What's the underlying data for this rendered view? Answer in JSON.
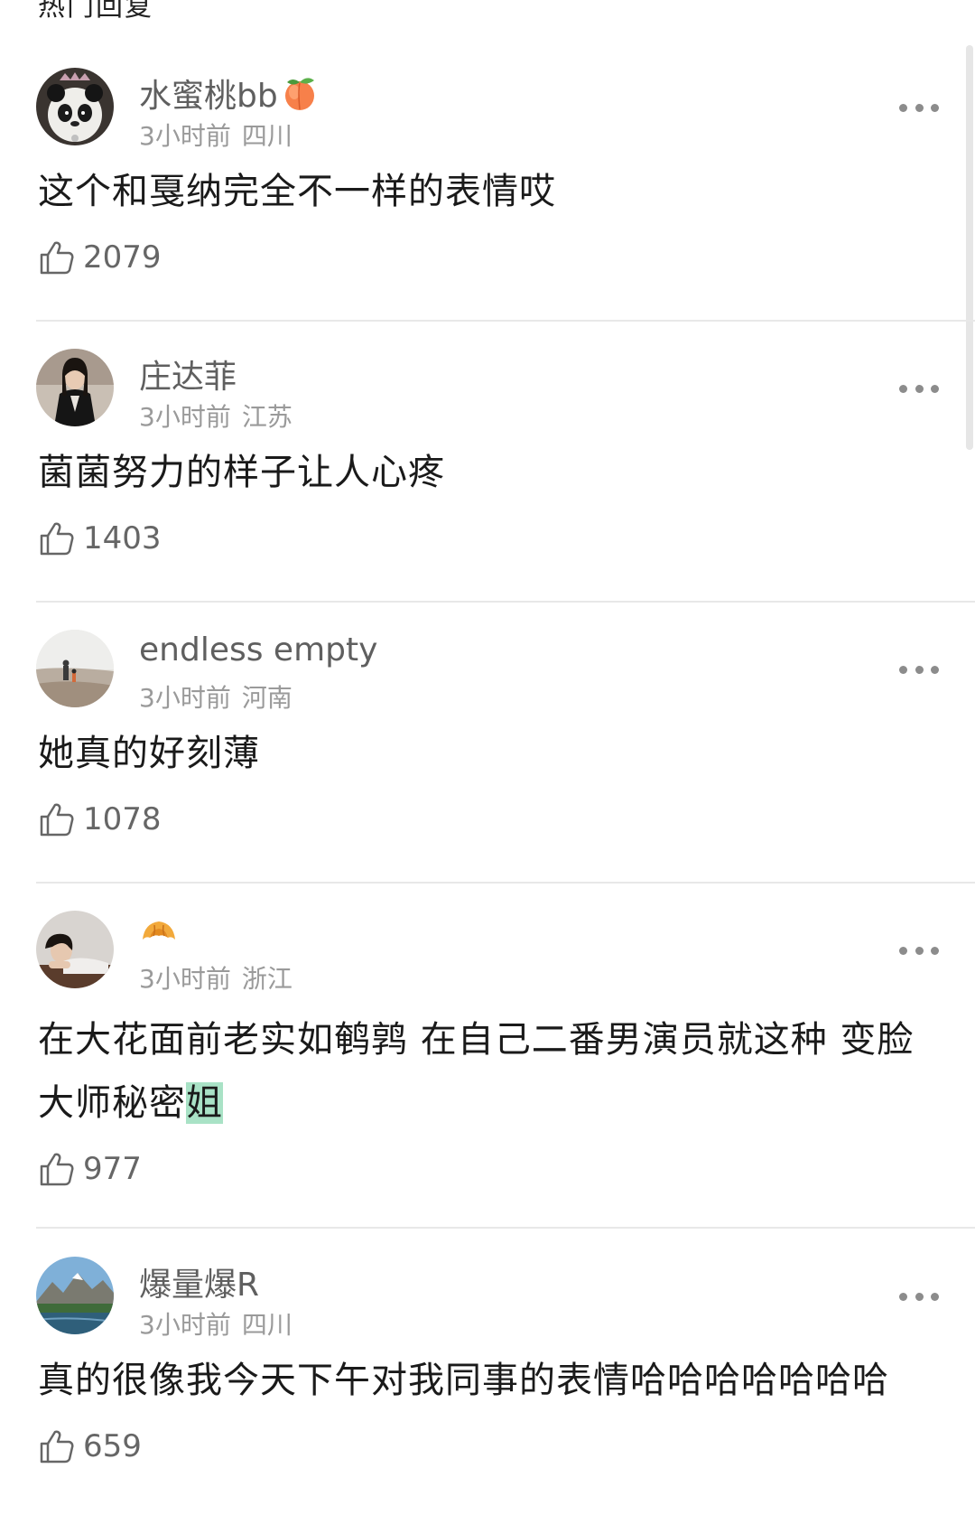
{
  "section_title": "热门回复",
  "comments": [
    {
      "username": "水蜜桃bb",
      "time": "3小时前",
      "location": "四川",
      "text": "这个和戛纳完全不一样的表情哎",
      "likes": "2079"
    },
    {
      "username": "庄达菲",
      "time": "3小时前",
      "location": "江苏",
      "text": "菌菌努力的样子让人心疼",
      "likes": "1403"
    },
    {
      "username": "endless empty",
      "time": "3小时前",
      "location": "河南",
      "text": "她真的好刻薄",
      "likes": "1078"
    },
    {
      "username": "",
      "time": "3小时前",
      "location": "浙江",
      "text_before_highlight": "在大花面前老实如鹌鹑 在自己二番男演员就这种 变脸大师秘密",
      "text_highlight": "姐",
      "likes": "977"
    },
    {
      "username": "爆量爆R",
      "time": "3小时前",
      "location": "四川",
      "text": "真的很像我今天下午对我同事的表情哈哈哈哈哈哈哈",
      "likes": "659"
    }
  ],
  "icons": {
    "username_emoji_1": "peach-emoji-icon",
    "username_emoji_4": "croissant-emoji-icon",
    "like": "thumbs-up-icon",
    "more": "more-dots-icon"
  },
  "colors": {
    "username": "#5f5f5f",
    "meta": "#9a9a9a",
    "highlight": "#a9e2c6",
    "divider": "#e8e8e8"
  }
}
